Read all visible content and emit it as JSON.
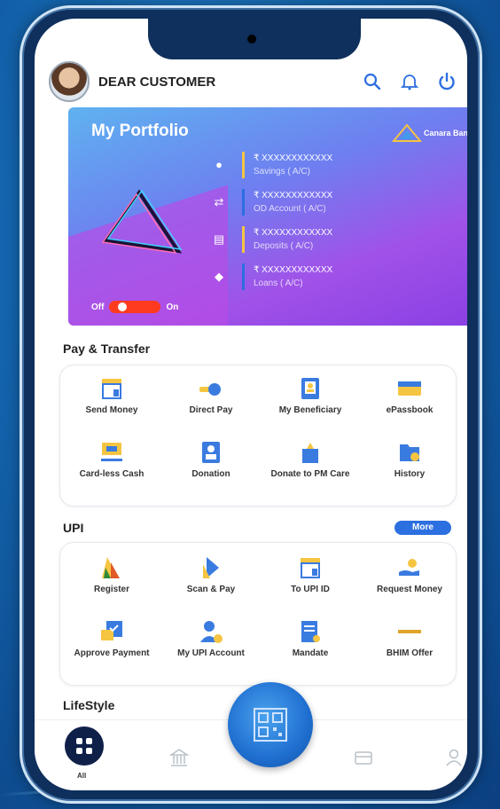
{
  "header": {
    "greeting": "DEAR CUSTOMER"
  },
  "portfolio": {
    "title": "My Portfolio",
    "bank_name": "Canara Bank",
    "accounts": [
      {
        "icon": "money-bag-icon",
        "amount": "₹ XXXXXXXXXXXX",
        "label": "Savings ( A/C)",
        "color": "#f5c542"
      },
      {
        "icon": "transfer-icon",
        "amount": "₹ XXXXXXXXXXXX",
        "label": "OD Account ( A/C)",
        "color": "#2c6fe0"
      },
      {
        "icon": "deposit-icon",
        "amount": "₹ XXXXXXXXXXXX",
        "label": "Deposits ( A/C)",
        "color": "#f5c542"
      },
      {
        "icon": "loan-icon",
        "amount": "₹ XXXXXXXXXXXX",
        "label": "Loans ( A/C)",
        "color": "#2c6fe0"
      }
    ],
    "toggle_off": "Off",
    "toggle_on": "On"
  },
  "pay_transfer": {
    "title": "Pay & Transfer",
    "items": [
      {
        "label": "Send Money",
        "icon": "send-money-icon"
      },
      {
        "label": "Direct Pay",
        "icon": "direct-pay-icon"
      },
      {
        "label": "My Beneficiary",
        "icon": "beneficiary-icon"
      },
      {
        "label": "ePassbook",
        "icon": "passbook-icon"
      },
      {
        "label": "Card-less Cash",
        "icon": "cardless-cash-icon"
      },
      {
        "label": "Donation",
        "icon": "donation-icon"
      },
      {
        "label": "Donate to PM Care",
        "icon": "pm-care-icon"
      },
      {
        "label": "History",
        "icon": "history-icon"
      }
    ]
  },
  "upi": {
    "title": "UPI",
    "more_label": "More",
    "items": [
      {
        "label": "Register",
        "icon": "register-icon"
      },
      {
        "label": "Scan & Pay",
        "icon": "scan-pay-icon"
      },
      {
        "label": "To UPI ID",
        "icon": "upi-id-icon"
      },
      {
        "label": "Request Money",
        "icon": "request-money-icon"
      },
      {
        "label": "Approve Payment",
        "icon": "approve-payment-icon"
      },
      {
        "label": "My UPI Account",
        "icon": "upi-account-icon"
      },
      {
        "label": "Mandate",
        "icon": "mandate-icon"
      },
      {
        "label": "BHIM Offer",
        "icon": "bhim-offer-icon"
      }
    ]
  },
  "lifestyle": {
    "title": "LifeStyle"
  },
  "bottom_nav": {
    "all_label": "All"
  },
  "colors": {
    "accent_blue": "#2c6fe0",
    "icon_gold": "#f5c542",
    "icon_blue": "#3a7be0",
    "toggle_red": "#ff3b1f",
    "nav_dark": "#0f2048"
  }
}
